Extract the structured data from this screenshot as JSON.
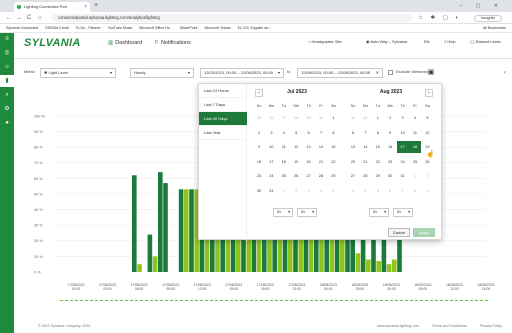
{
  "browser": {
    "tab_title": "Lighting Connected Port",
    "new_tab_symbol": "+",
    "window_controls": "–  ▢  ✕",
    "nav_back": "←",
    "nav_forward": "→",
    "nav_reload": "C",
    "nav_home": "⌂",
    "url": "connectedportal.sylvania-lighting.com/analytics/lighting",
    "profile_label": "Incognito",
    "bookmarks": [
      "Sylvania Connected",
      "OSRAM Credit",
      "To Do - Planner",
      "YouTube Music",
      "Microsoft Office Ho...",
      "SharePoint",
      "Microsoft Teams",
      "EL-XIC Supplier an..."
    ],
    "bookmarks_all": "All Bookmarks"
  },
  "app": {
    "logo": "SYLVANIA",
    "nav": [
      {
        "label": "Dashboard",
        "icon": "bar-chart-icon"
      },
      {
        "label": "Notifications",
        "icon": "bell-icon"
      }
    ],
    "header_right": {
      "site": "Headquarter Site",
      "org": "Auto Way – Sylvania",
      "lang": "EN",
      "help": "Help",
      "user": "Edward Lewis"
    }
  },
  "filters": {
    "metric_label": "Metric",
    "metric_value": "Light Level",
    "interval_value": "Hourly",
    "from_value": "12/03/2023, 00:00 – 12/08/2023, 00:00",
    "to_label": "to",
    "to_value": "12/09/2023, 00:00 – 12/08/2023, 00:55",
    "exclude_weekend": "Exclude Weekend"
  },
  "chart_data": {
    "type": "bar",
    "ylabel": "",
    "y_ticks": [
      "100 %",
      "90 %",
      "80 %",
      "70 %",
      "60 %",
      "50 %",
      "40 %",
      "30 %",
      "20 %",
      "10 %",
      "0 %"
    ],
    "ylim": [
      0,
      100
    ],
    "x_ticks": [
      "17/08/2023, 00:00",
      "17/08/2023, 03:00",
      "17/08/2023, 06:00",
      "17/08/2023, 09:00",
      "17/08/2023, 12:00",
      "17/08/2023, 15:00",
      "17/08/2023, 18:00",
      "17/08/2023, 21:00",
      "18/08/2023, 00:00",
      "18/08/2023, 03:00",
      "18/08/2023, 06:00",
      "18/08/2023, 09:00",
      "18/08/2023, 12:00",
      "18/08/2023, 15:00"
    ],
    "series": [
      {
        "color": "#1b7a3c",
        "values": [
          0,
          0,
          0,
          0,
          0,
          0,
          36,
          0,
          0,
          0,
          0,
          0,
          0,
          0,
          0,
          0,
          0,
          0,
          0,
          0,
          0,
          0,
          0,
          0,
          0,
          0,
          0,
          0,
          0,
          0,
          0,
          0,
          0,
          0,
          0,
          0,
          0,
          0,
          0,
          0,
          0,
          0,
          0,
          0,
          0,
          0,
          0,
          0,
          0,
          0,
          0,
          0,
          0,
          0
        ]
      },
      {
        "color": "#8fc41f",
        "values": [
          0,
          0,
          0,
          0,
          0,
          0,
          0,
          0,
          0,
          0,
          0,
          0,
          0,
          0,
          0,
          0,
          0,
          0,
          0,
          0,
          0,
          0,
          0,
          0,
          0,
          0,
          0,
          0,
          0,
          0,
          0,
          0,
          0,
          0,
          0,
          0,
          0,
          0,
          0,
          0,
          0,
          0,
          0,
          0,
          0,
          0,
          0,
          0,
          0,
          0,
          0,
          0,
          0,
          0
        ]
      }
    ],
    "bars": [
      {
        "v": 62,
        "c": "#1b7a3c"
      },
      {
        "v": 5,
        "c": "#8fc41f"
      },
      {
        "v": 0,
        "c": "#8fc41f"
      },
      {
        "v": 24,
        "c": "#1b7a3c"
      },
      {
        "v": 10,
        "c": "#8fc41f"
      },
      {
        "v": 64,
        "c": "#1b7a3c"
      },
      {
        "v": 57,
        "c": "#1b7a3c"
      },
      {
        "v": 0,
        "c": "#8fc41f"
      },
      {
        "v": 0,
        "c": "#8fc41f"
      },
      {
        "v": 53,
        "c": "#1b7a3c"
      },
      {
        "v": 53,
        "c": "#8fc41f"
      },
      {
        "v": 53,
        "c": "#1b7a3c"
      },
      {
        "v": 53,
        "c": "#8fc41f"
      },
      {
        "v": 53,
        "c": "#1b7a3c"
      },
      {
        "v": 53,
        "c": "#8fc41f"
      },
      {
        "v": 53,
        "c": "#1b7a3c"
      },
      {
        "v": 53,
        "c": "#8fc41f"
      },
      {
        "v": 53,
        "c": "#1b7a3c"
      },
      {
        "v": 53,
        "c": "#8fc41f"
      },
      {
        "v": 53,
        "c": "#1b7a3c"
      },
      {
        "v": 53,
        "c": "#8fc41f"
      },
      {
        "v": 53,
        "c": "#1b7a3c"
      },
      {
        "v": 53,
        "c": "#8fc41f"
      },
      {
        "v": 53,
        "c": "#1b7a3c"
      },
      {
        "v": 53,
        "c": "#8fc41f"
      },
      {
        "v": 53,
        "c": "#1b7a3c"
      },
      {
        "v": 53,
        "c": "#8fc41f"
      },
      {
        "v": 53,
        "c": "#1b7a3c"
      },
      {
        "v": 53,
        "c": "#8fc41f"
      },
      {
        "v": 53,
        "c": "#1b7a3c"
      },
      {
        "v": 53,
        "c": "#8fc41f"
      },
      {
        "v": 53,
        "c": "#1b7a3c"
      },
      {
        "v": 53,
        "c": "#8fc41f"
      },
      {
        "v": 53,
        "c": "#1b7a3c"
      },
      {
        "v": 53,
        "c": "#8fc41f"
      },
      {
        "v": 53,
        "c": "#1b7a3c"
      },
      {
        "v": 53,
        "c": "#8fc41f"
      },
      {
        "v": 53,
        "c": "#1b7a3c"
      },
      {
        "v": 53,
        "c": "#8fc41f"
      },
      {
        "v": 53,
        "c": "#1b7a3c"
      },
      {
        "v": 53,
        "c": "#8fc41f"
      },
      {
        "v": 53,
        "c": "#1b7a3c"
      },
      {
        "v": 60,
        "c": "#1b7a3c"
      },
      {
        "v": 12,
        "c": "#8fc41f"
      },
      {
        "v": 30,
        "c": "#1b7a3c"
      },
      {
        "v": 8,
        "c": "#8fc41f"
      },
      {
        "v": 50,
        "c": "#1b7a3c"
      },
      {
        "v": 7,
        "c": "#8fc41f"
      },
      {
        "v": 21,
        "c": "#1b7a3c"
      },
      {
        "v": 5,
        "c": "#8fc41f"
      },
      {
        "v": 8,
        "c": "#8fc41f"
      },
      {
        "v": 22,
        "c": "#1b7a3c"
      }
    ]
  },
  "datepicker": {
    "presets": [
      "Last 24 Hours",
      "Last 7 Days",
      "Last 30 Days",
      "Last Year"
    ],
    "active_preset": 2,
    "left": {
      "title": "Jul 2023",
      "dows": [
        "Su",
        "Mo",
        "Tu",
        "We",
        "Th",
        "Fr",
        "Sa"
      ],
      "days": [
        "25",
        "26",
        "27",
        "28",
        "29",
        "30",
        "1",
        "2",
        "3",
        "4",
        "5",
        "6",
        "7",
        "8",
        "9",
        "10",
        "11",
        "12",
        "13",
        "14",
        "15",
        "16",
        "17",
        "18",
        "19",
        "20",
        "21",
        "22",
        "23",
        "24",
        "25",
        "26",
        "27",
        "28",
        "29",
        "30",
        "31",
        "1",
        "2",
        "3",
        "4",
        "5"
      ],
      "muted": [
        0,
        1,
        2,
        3,
        4,
        5,
        37,
        38,
        39,
        40,
        41
      ],
      "time_h": "00",
      "time_m": "00"
    },
    "right": {
      "title": "Aug 2023",
      "dows": [
        "Su",
        "Mo",
        "Tu",
        "We",
        "Th",
        "Fr",
        "Sa"
      ],
      "days": [
        "30",
        "31",
        "1",
        "2",
        "3",
        "4",
        "5",
        "6",
        "7",
        "8",
        "9",
        "10",
        "11",
        "12",
        "13",
        "14",
        "15",
        "16",
        "17",
        "18",
        "19",
        "20",
        "21",
        "22",
        "23",
        "24",
        "25",
        "26",
        "27",
        "28",
        "29",
        "30",
        "31",
        "1",
        "2",
        "3",
        "4",
        "5",
        "6",
        "7",
        "8",
        "9"
      ],
      "muted": [
        0,
        1,
        33,
        34,
        35,
        36,
        37,
        38,
        39,
        40,
        41
      ],
      "selected": [
        18,
        19
      ],
      "time_h": "00",
      "time_m": "00"
    },
    "prev": "‹",
    "next": "›",
    "cancel": "Cancel",
    "apply": "Apply"
  },
  "footer": {
    "copyright": "© 2023 Sylvania Company. 2023",
    "links": [
      "www.sylvania-lighting.com",
      "Terms and Conditions",
      "Privacy Policy"
    ]
  }
}
